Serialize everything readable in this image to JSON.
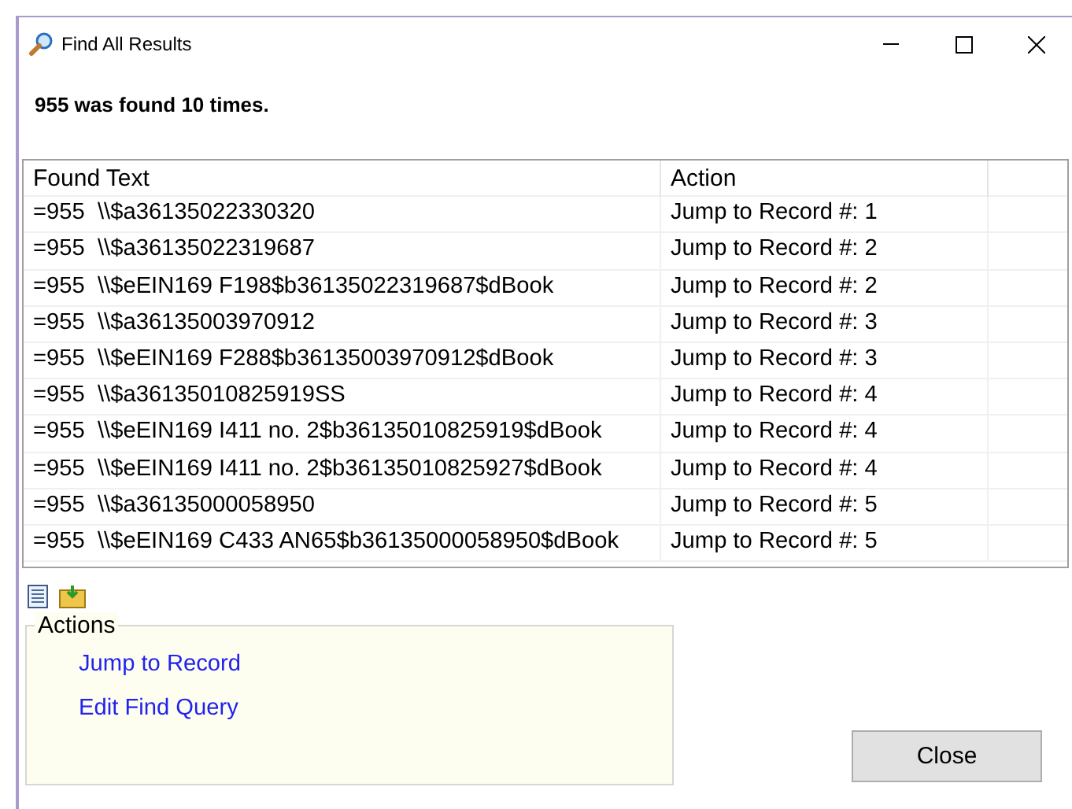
{
  "window": {
    "title": "Find All Results"
  },
  "summary": "955 was found 10 times.",
  "table": {
    "columns": [
      "Found Text",
      "Action"
    ],
    "rows": [
      {
        "found_text": "=955  \\\\$a36135022330320",
        "action": "Jump to Record #: 1"
      },
      {
        "found_text": "=955  \\\\$a36135022319687",
        "action": "Jump to Record #: 2"
      },
      {
        "found_text": "=955  \\\\$eEIN169 F198$b36135022319687$dBook",
        "action": "Jump to Record #: 2"
      },
      {
        "found_text": "=955  \\\\$a36135003970912",
        "action": "Jump to Record #: 3"
      },
      {
        "found_text": "=955  \\\\$eEIN169 F288$b36135003970912$dBook",
        "action": "Jump to Record #: 3"
      },
      {
        "found_text": "=955  \\\\$a36135010825919SS",
        "action": "Jump to Record #: 4"
      },
      {
        "found_text": "=955  \\\\$eEIN169 I411 no. 2$b36135010825919$dBook",
        "action": "Jump to Record #: 4"
      },
      {
        "found_text": "=955  \\\\$eEIN169 I411 no. 2$b36135010825927$dBook",
        "action": "Jump to Record #: 4"
      },
      {
        "found_text": "=955  \\\\$a36135000058950",
        "action": "Jump to Record #: 5"
      },
      {
        "found_text": "=955  \\\\$eEIN169 C433 AN65$b36135000058950$dBook",
        "action": "Jump to Record #: 5"
      }
    ]
  },
  "actions": {
    "title": "Actions",
    "links": [
      "Jump to Record",
      "Edit Find Query"
    ]
  },
  "close_button": "Close"
}
